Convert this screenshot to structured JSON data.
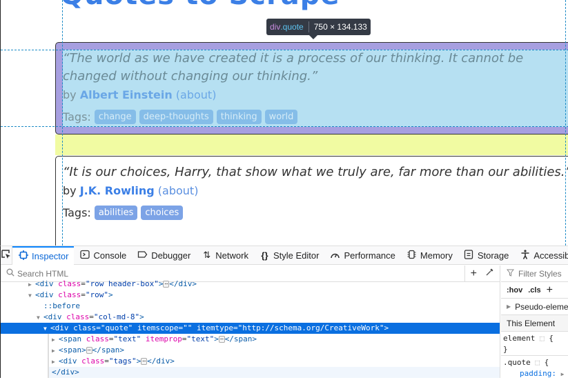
{
  "page": {
    "title": "Quotes to Scrape",
    "quotes": [
      {
        "text": "“The world as we have created it is a process of our thinking. It cannot be changed without changing our thinking.”",
        "by": "by",
        "author": "Albert Einstein",
        "about": "(about)",
        "tags_label": "Tags:",
        "tags": [
          "change",
          "deep-thoughts",
          "thinking",
          "world"
        ]
      },
      {
        "text": "“It is our choices, Harry, that show what we truly are, far more than our abilities.”",
        "by": "by",
        "author": "J.K. Rowling",
        "about": "(about)",
        "tags_label": "Tags:",
        "tags": [
          "abilities",
          "choices"
        ]
      }
    ]
  },
  "highlighter": {
    "tag": "div",
    "class": ".quote",
    "dimensions": "750 × 134.133",
    "colors": {
      "margin": "#f1fba2",
      "padding": "#a79fe0",
      "content": "#b6e0f2"
    }
  },
  "devtools": {
    "tabs": [
      {
        "label": "Inspector",
        "icon": "inspector-icon",
        "active": true
      },
      {
        "label": "Console",
        "icon": "console-icon"
      },
      {
        "label": "Debugger",
        "icon": "debugger-icon"
      },
      {
        "label": "Network",
        "icon": "network-icon"
      },
      {
        "label": "Style Editor",
        "icon": "style-editor-icon"
      },
      {
        "label": "Performance",
        "icon": "performance-icon"
      },
      {
        "label": "Memory",
        "icon": "memory-icon"
      },
      {
        "label": "Storage",
        "icon": "storage-icon"
      },
      {
        "label": "Accessibility",
        "icon": "accessibility-icon"
      }
    ],
    "search_placeholder": "Search HTML",
    "markup": {
      "line0": {
        "tag": "<div",
        "attr": "class",
        "val": "\"row header-box\"",
        "close": "</div>"
      },
      "line1": {
        "tag": "<div",
        "attr": "class",
        "val": "\"row\"",
        "end": ">"
      },
      "line2": {
        "pseudo": "::before"
      },
      "line3": {
        "tag": "<div",
        "attr": "class",
        "val": "\"col-md-8\"",
        "end": ">"
      },
      "line4": {
        "tag": "<div",
        "attr1": "class",
        "val1": "\"quote\"",
        "attr2": "itemscope",
        "val2": "\"\"",
        "attr3": "itemtype",
        "val3": "\"http://schema.org/CreativeWork\"",
        "end": ">"
      },
      "line5": {
        "tag": "<span",
        "attr1": "class",
        "val1": "\"text\"",
        "attr2": "itemprop",
        "val2": "\"text\"",
        "close": "</span>"
      },
      "line6": {
        "tag": "<span>",
        "close": "</span>"
      },
      "line7": {
        "tag": "<div",
        "attr": "class",
        "val": "\"tags\"",
        "close": "</div>"
      },
      "line8": {
        "close": "</div>"
      }
    },
    "rules": {
      "filter_placeholder": "Filter Styles",
      "hov": ":hov",
      "cls": ".cls",
      "pseudo_elements": "Pseudo-elements",
      "this_element": "This Element",
      "element_rule": "element",
      "quote_rule": ".quote",
      "padding_prop": "padding:"
    }
  }
}
